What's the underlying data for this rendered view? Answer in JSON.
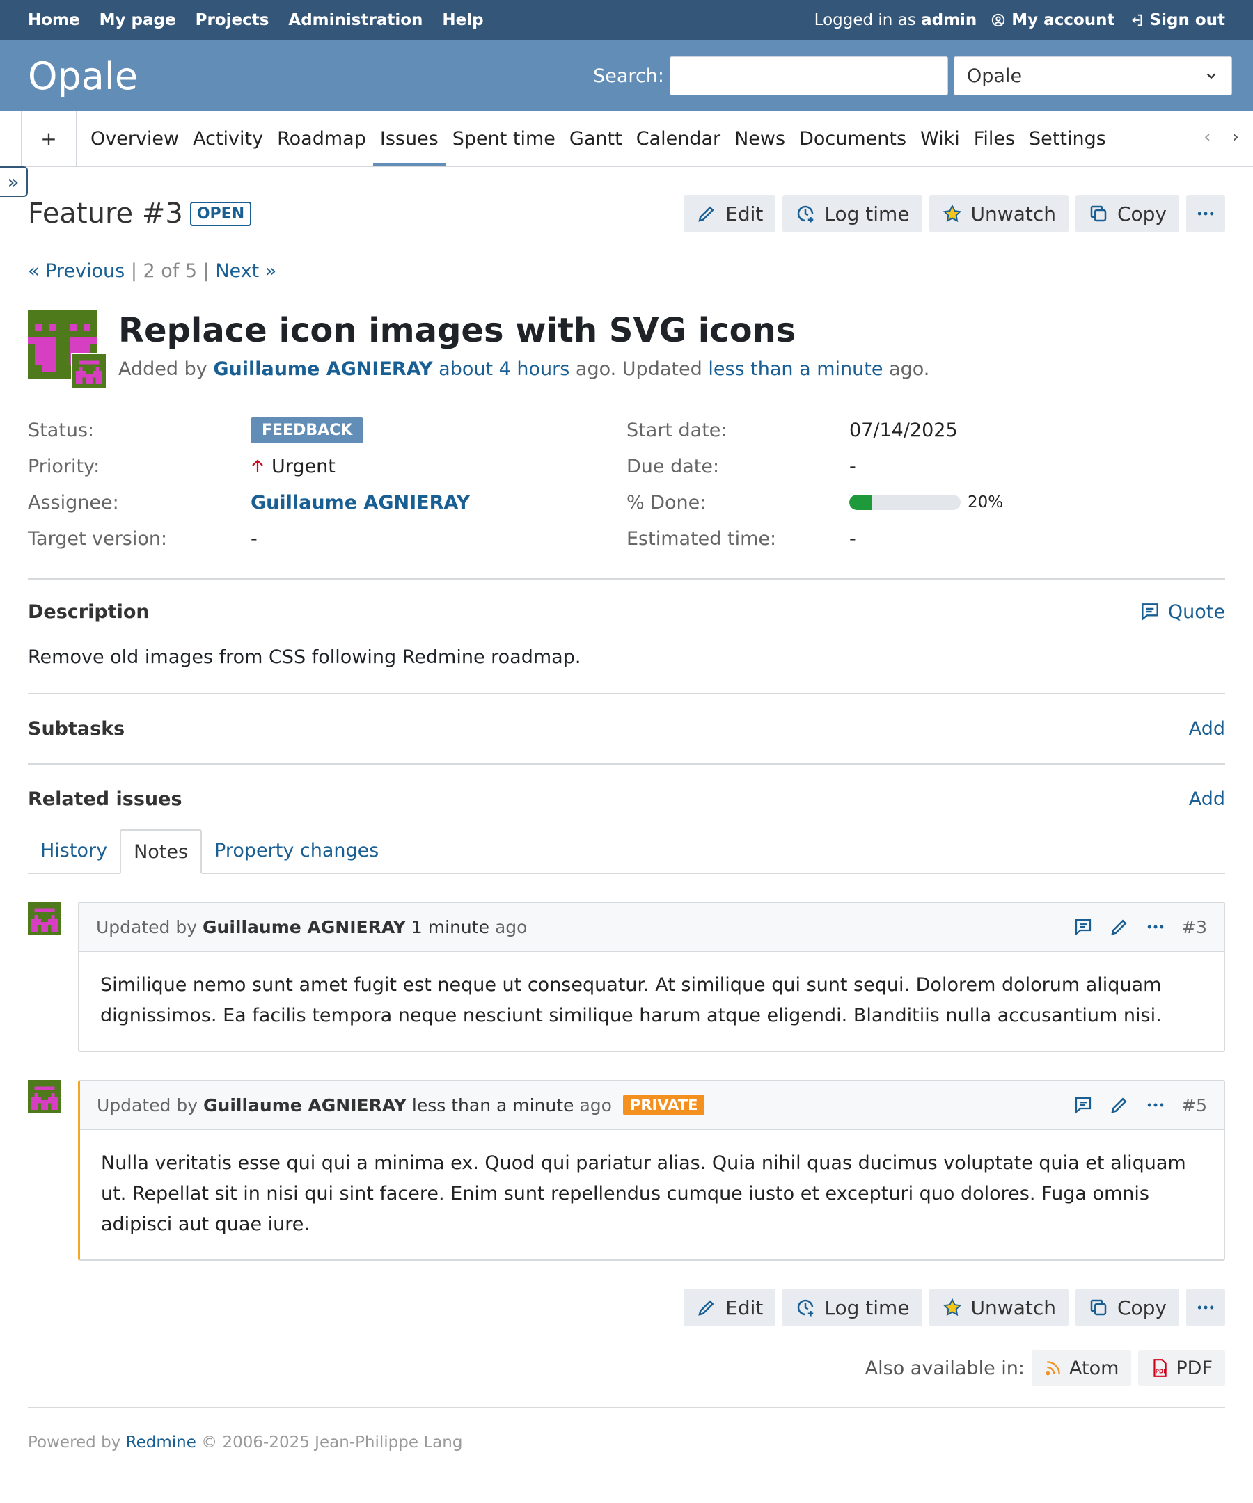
{
  "topnav": {
    "items": [
      "Home",
      "My page",
      "Projects",
      "Administration",
      "Help"
    ],
    "logged_in_prefix": "Logged in as",
    "user": "admin",
    "my_account": "My account",
    "sign_out": "Sign out"
  },
  "header": {
    "title": "Opale",
    "search_label": "Search:",
    "search_value": "",
    "project_select": "Opale"
  },
  "tabs": {
    "plus": "+",
    "items": [
      "Overview",
      "Activity",
      "Roadmap",
      "Issues",
      "Spent time",
      "Gantt",
      "Calendar",
      "News",
      "Documents",
      "Wiki",
      "Files",
      "Settings"
    ],
    "selected": "Issues"
  },
  "issue": {
    "title": "Feature #3",
    "state": "OPEN",
    "actions": {
      "edit": "Edit",
      "log_time": "Log time",
      "unwatch": "Unwatch",
      "copy": "Copy"
    },
    "nav": {
      "previous": "« Previous",
      "position": "2 of 5",
      "next": "Next »"
    },
    "subject": "Replace icon images with SVG icons",
    "added_by_prefix": "Added by",
    "author": "Guillaume AGNIERAY",
    "created": "about 4 hours",
    "ago1": "ago. Updated",
    "updated": "less than a minute",
    "ago2": "ago.",
    "attributes": {
      "status_label": "Status:",
      "status": "FEEDBACK",
      "priority_label": "Priority:",
      "priority": "Urgent",
      "assignee_label": "Assignee:",
      "assignee": "Guillaume AGNIERAY",
      "target_label": "Target version:",
      "target": "-",
      "start_label": "Start date:",
      "start": "07/14/2025",
      "due_label": "Due date:",
      "due": "-",
      "done_label": "% Done:",
      "done": "20%",
      "done_fraction": 0.2,
      "estimated_label": "Estimated time:",
      "estimated": "-"
    },
    "description_heading": "Description",
    "quote": "Quote",
    "description": "Remove old images from CSS following Redmine roadmap.",
    "subtasks_heading": "Subtasks",
    "related_heading": "Related issues",
    "add": "Add"
  },
  "history_tabs": [
    "History",
    "Notes",
    "Property changes"
  ],
  "notes": [
    {
      "prefix": "Updated by",
      "author": "Guillaume AGNIERAY",
      "time": "1 minute",
      "ago": "ago",
      "number": "#3",
      "text": "Similique nemo sunt amet fugit est neque ut consequatur. At similique qui sunt sequi. Dolorem dolorum aliquam dignissimos. Ea facilis tempora neque nesciunt similique harum atque eligendi. Blanditiis nulla accusantium nisi."
    },
    {
      "prefix": "Updated by",
      "author": "Guillaume AGNIERAY",
      "time": "less than a minute",
      "ago": "ago",
      "private": "PRIVATE",
      "number": "#5",
      "text": "Nulla veritatis esse qui qui a minima ex. Quod qui pariatur alias. Quia nihil quas ducimus voluptate quia et aliquam ut. Repellat sit in nisi qui sint facere. Enim sunt repellendus cumque iusto et excepturi quo dolores. Fuga omnis adipisci aut quae iure."
    }
  ],
  "formats": {
    "label": "Also available in:",
    "atom": "Atom",
    "pdf": "PDF"
  },
  "footer": {
    "prefix": "Powered by",
    "link": "Redmine",
    "suffix": "© 2006-2025 Jean-Philippe Lang"
  },
  "colors": {
    "topbar": "#345679",
    "header": "#628db6",
    "link": "#1a5f93",
    "progress": "#1f9a3a",
    "private": "#f39020"
  }
}
